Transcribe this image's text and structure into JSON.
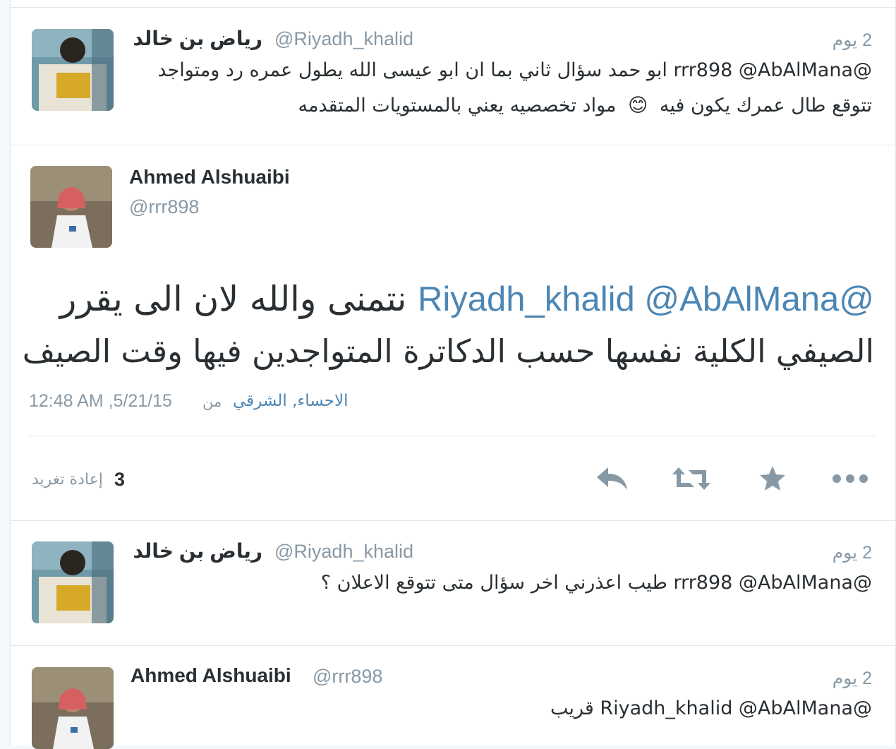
{
  "tweets": [
    {
      "name": "رياض بن خالد",
      "handle": "@Riyadh_khalid",
      "time": "2 يوم",
      "line1": "@rrr898 @AbAlMana ابو حمد سؤال ثاني بما ان ابو عيسى الله يطول عمره رد ومتواجد",
      "line2a": "تتوقع طال عمرك يكون فيه",
      "emoji": "😊",
      "line2b": "مواد تخصصيه يعني بالمستويات المتقدمه"
    },
    {
      "name": "رياض بن خالد",
      "handle": "@Riyadh_khalid",
      "time": "2 يوم",
      "line1": "@rrr898 @AbAlMana طيب اعذرني اخر سؤال متى تتوقع الاعلان ؟"
    },
    {
      "name": "Ahmed Alshuaibi",
      "handle": "@rrr898",
      "time": "2 يوم",
      "line1": "@Riyadh_khalid @AbAlMana قريب"
    }
  ],
  "main_tweet": {
    "name": "Ahmed Alshuaibi",
    "handle": "@rrr898",
    "mentions": "@Riyadh_khalid @AbAlMana",
    "line1_text": "نتمنى والله لان الى يقرر",
    "line2": "الصيفي الكلية نفسها حسب الدكاترة المتواجدين فيها وقت الصيف",
    "date": "12:48 AM ,5/21/15",
    "from": "من",
    "place": "الاحساء, الشرقي",
    "retweet_count": "3",
    "retweet_label": "إعادة تغريد"
  },
  "icons": {
    "reply": "reply-icon",
    "retweet": "retweet-icon",
    "favorite": "star-icon",
    "more": "more-dots-icon"
  },
  "colors": {
    "link": "#4b86b4",
    "icon": "#8899a6",
    "text": "#292f33"
  }
}
